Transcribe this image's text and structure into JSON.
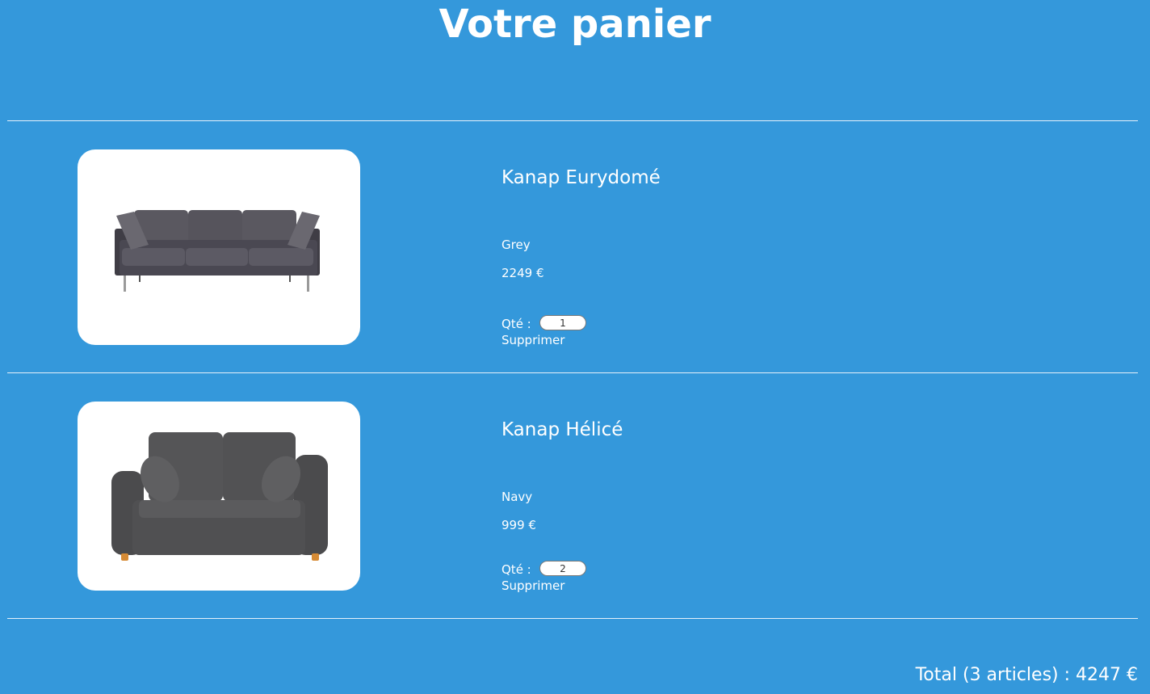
{
  "page": {
    "title": "Votre panier"
  },
  "colors": {
    "background": "#3498db",
    "text": "#ffffff",
    "card": "#ffffff",
    "divider": "#e6f1fb"
  },
  "cart": {
    "items": [
      {
        "name": "Kanap Eurydomé",
        "color": "Grey",
        "price": "2249 €",
        "quantity_label": "Qté :",
        "quantity": "1",
        "delete_label": "Supprimer",
        "image_icon": "three-seat-sofa-icon"
      },
      {
        "name": "Kanap Hélicé",
        "color": "Navy",
        "price": "999 €",
        "quantity_label": "Qté :",
        "quantity": "2",
        "delete_label": "Supprimer",
        "image_icon": "two-seat-sofa-icon"
      }
    ],
    "total": "Total (3 articles) : 4247 €"
  }
}
